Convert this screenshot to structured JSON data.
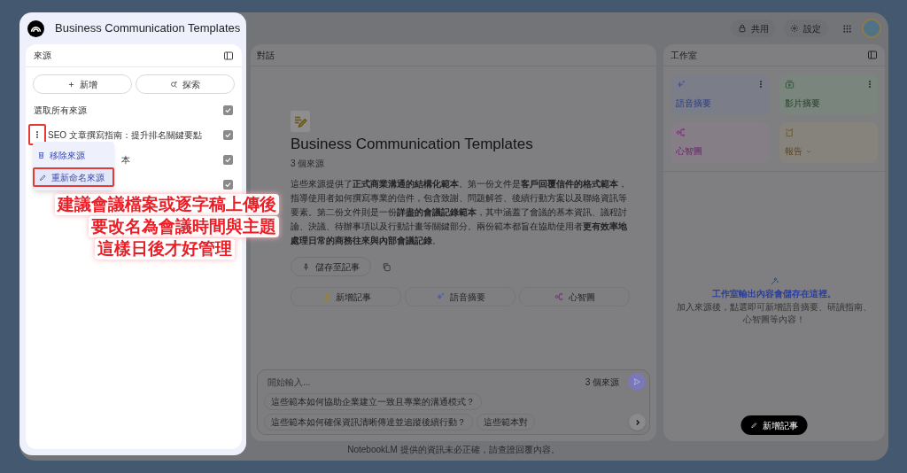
{
  "notebook": {
    "title": "Business Communication Templates"
  },
  "top_bar": {
    "actions": [
      {
        "kind": "share",
        "label": "共用"
      },
      {
        "kind": "settings",
        "label": "設定"
      }
    ]
  },
  "sources_panel": {
    "title": "來源",
    "buttons": [
      {
        "kind": "add",
        "label": "新增"
      },
      {
        "kind": "discover",
        "label": "探索"
      }
    ],
    "select_all": {
      "label": "選取所有來源",
      "checked": true
    },
    "items": [
      {
        "kind": "full",
        "title": "SEO 文章撰寫指南：提升排名關鍵要點",
        "checked": true,
        "annotated": true
      },
      {
        "kind": "covered",
        "title": "本",
        "checked": true
      },
      {
        "kind": "hidden",
        "checked": true
      }
    ],
    "context_menu": [
      {
        "kind": "delete",
        "label": "移除來源",
        "annotated": false
      },
      {
        "kind": "rename",
        "label": "重新命名來源",
        "annotated": true
      }
    ]
  },
  "annotation": {
    "lines": [
      "建議會議檔案或逐字稿上傳後",
      "要改名為會議時間與主題",
      "這樣日後才好管理"
    ]
  },
  "chat_panel": {
    "title": "對話",
    "notebook_title": "Business Communication Templates",
    "source_count": "3 個來源",
    "summary": "這些來源提供了**正式商業溝通的結構化範本**。第一份文件是**客戶回覆信件的格式範本**，指導使用者如何撰寫專業的信件，包含致謝、問題解答、後續行動方案以及聯絡資訊等要素。第二份文件則是一份**詳盡的會議記錄範本**，其中涵蓋了會議的基本資訊、議程討論、決議、待辦事項以及行動計畫等關鍵部分。兩份範本都旨在協助使用者**更有效率地處理日常的商務往來與內部會議記錄**。",
    "save_button": "儲存至記事",
    "actions": [
      {
        "kind": "note",
        "label": "新增記事"
      },
      {
        "kind": "audio",
        "label": "語音摘要"
      },
      {
        "kind": "mindmap",
        "label": "心智圖"
      }
    ],
    "input": {
      "placeholder": "開始輸入...",
      "source_count": "3 個來源"
    },
    "suggestions": [
      "這些範本如何協助企業建立一致且專業的溝通模式？",
      "這些範本如何確保資訊清晰傳達並追蹤後續行動？",
      "這些範本對"
    ]
  },
  "studio_panel": {
    "title": "工作室",
    "tiles": [
      {
        "kind": "audio",
        "label": "語音摘要",
        "more": true
      },
      {
        "kind": "video",
        "label": "影片摘要",
        "more": true
      },
      {
        "kind": "mindmap",
        "label": "心智圖",
        "more": false
      },
      {
        "kind": "report",
        "label": "報告",
        "more": false
      }
    ],
    "empty_title": "工作室輸出內容會儲存在這裡。",
    "empty_text": "加入來源後，點選即可新增語音摘要、研讀指南、心智圖等內容！",
    "add_note": "新增記事"
  },
  "footer": "NotebookLM 提供的資訊未必正確，請查證回覆內容。"
}
